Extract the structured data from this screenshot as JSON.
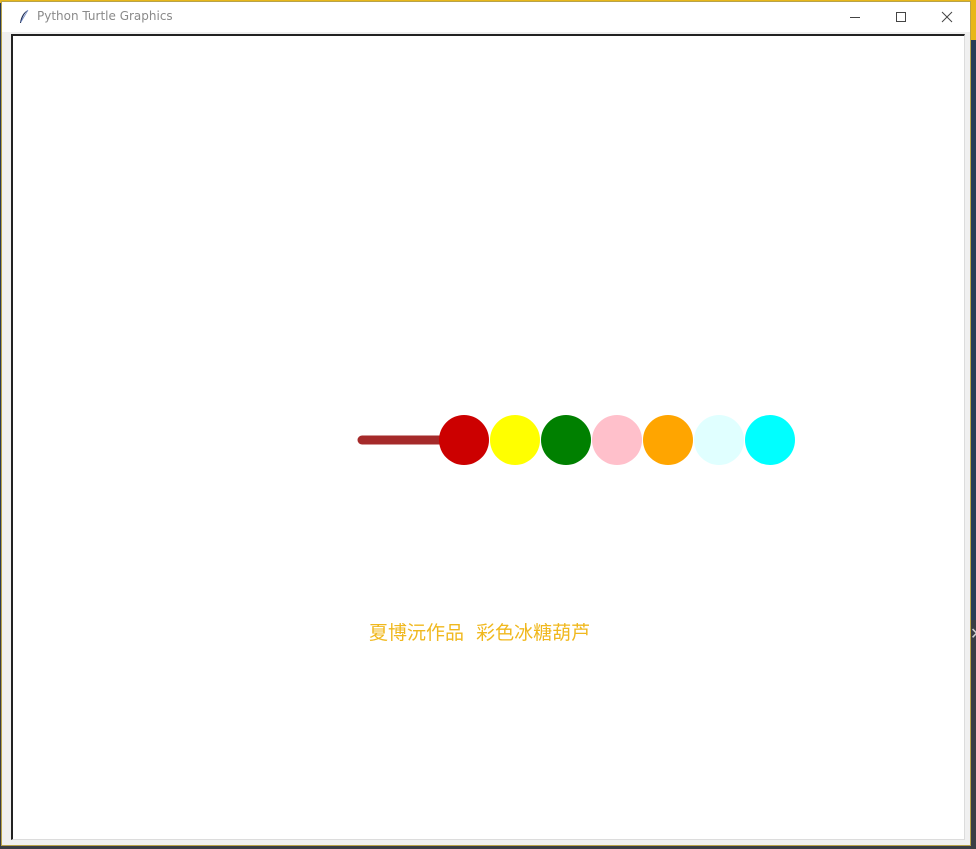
{
  "window": {
    "title": "Python Turtle Graphics",
    "icon": "feather-icon",
    "controls": {
      "minimize": "minimize-icon",
      "maximize": "maximize-icon",
      "close": "close-icon"
    }
  },
  "canvas": {
    "background": "#ffffff",
    "stick_color": "#a52a2a",
    "balls": [
      {
        "name": "red",
        "color": "#cc0000"
      },
      {
        "name": "yellow",
        "color": "#ffff00"
      },
      {
        "name": "green",
        "color": "#008000"
      },
      {
        "name": "pink",
        "color": "#ffc0cb"
      },
      {
        "name": "orange",
        "color": "#ffa500"
      },
      {
        "name": "lightcyan",
        "color": "#e0ffff"
      },
      {
        "name": "cyan",
        "color": "#00ffff"
      }
    ],
    "caption": {
      "text": "夏博沅作品  彩色冰糖葫芦",
      "color": "#f0b81e"
    }
  }
}
